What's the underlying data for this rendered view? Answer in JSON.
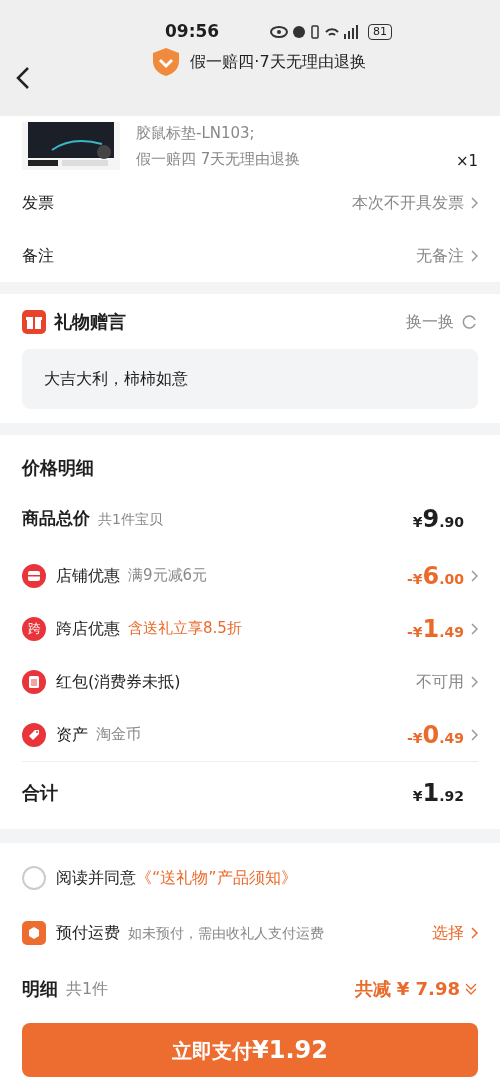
{
  "status_bar": {
    "time": "09:56",
    "battery": "81"
  },
  "header": {
    "guarantee": "假一赔四·7天无理由退换"
  },
  "product": {
    "spec": "胶鼠标垫-LN103;",
    "service": "假一赔四  7天无理由退换",
    "quantity": "×1"
  },
  "order_rows": [
    {
      "label": "发票",
      "value": "本次不开具发票"
    },
    {
      "label": "备注",
      "value": "无备注"
    }
  ],
  "gift_message": {
    "title": "礼物赠言",
    "action": "换一换",
    "message": "大吉大利，柿柿如意"
  },
  "price_detail": {
    "title": "价格明细",
    "subtotal": {
      "label": "商品总价",
      "note": "共1件宝贝",
      "amount": "¥9.90"
    },
    "discounts": [
      {
        "kind": "store",
        "label": "店铺优惠",
        "note": "满9元减6元",
        "note_highlight": false,
        "amount": "-¥6.00",
        "amount_highlight": true
      },
      {
        "kind": "cross",
        "icon_text": "跨",
        "label": "跨店优惠",
        "note": "含送礼立享8.5折",
        "note_highlight": true,
        "amount": "-¥1.49",
        "amount_highlight": true
      },
      {
        "kind": "envelope",
        "label": "红包(消费券未抵)",
        "amount": "不可用",
        "amount_highlight": false
      },
      {
        "kind": "tag",
        "label": "资产",
        "note": "淘金币",
        "note_highlight": false,
        "amount": "-¥0.49",
        "amount_highlight": true
      }
    ],
    "total": {
      "label": "合计",
      "amount": "¥1.92"
    }
  },
  "agreement": {
    "checked": false,
    "text": "阅读并同意",
    "link": "《“送礼物”产品须知》"
  },
  "shipping": {
    "label": "预付运费",
    "note": "如未预付，需由收礼人支付运费",
    "action": "选择"
  },
  "summary": {
    "label": "明细",
    "count": "共1件",
    "saving": "共减 ¥ 7.98"
  },
  "pay_button": {
    "label": "立即支付",
    "amount": "¥1.92"
  }
}
